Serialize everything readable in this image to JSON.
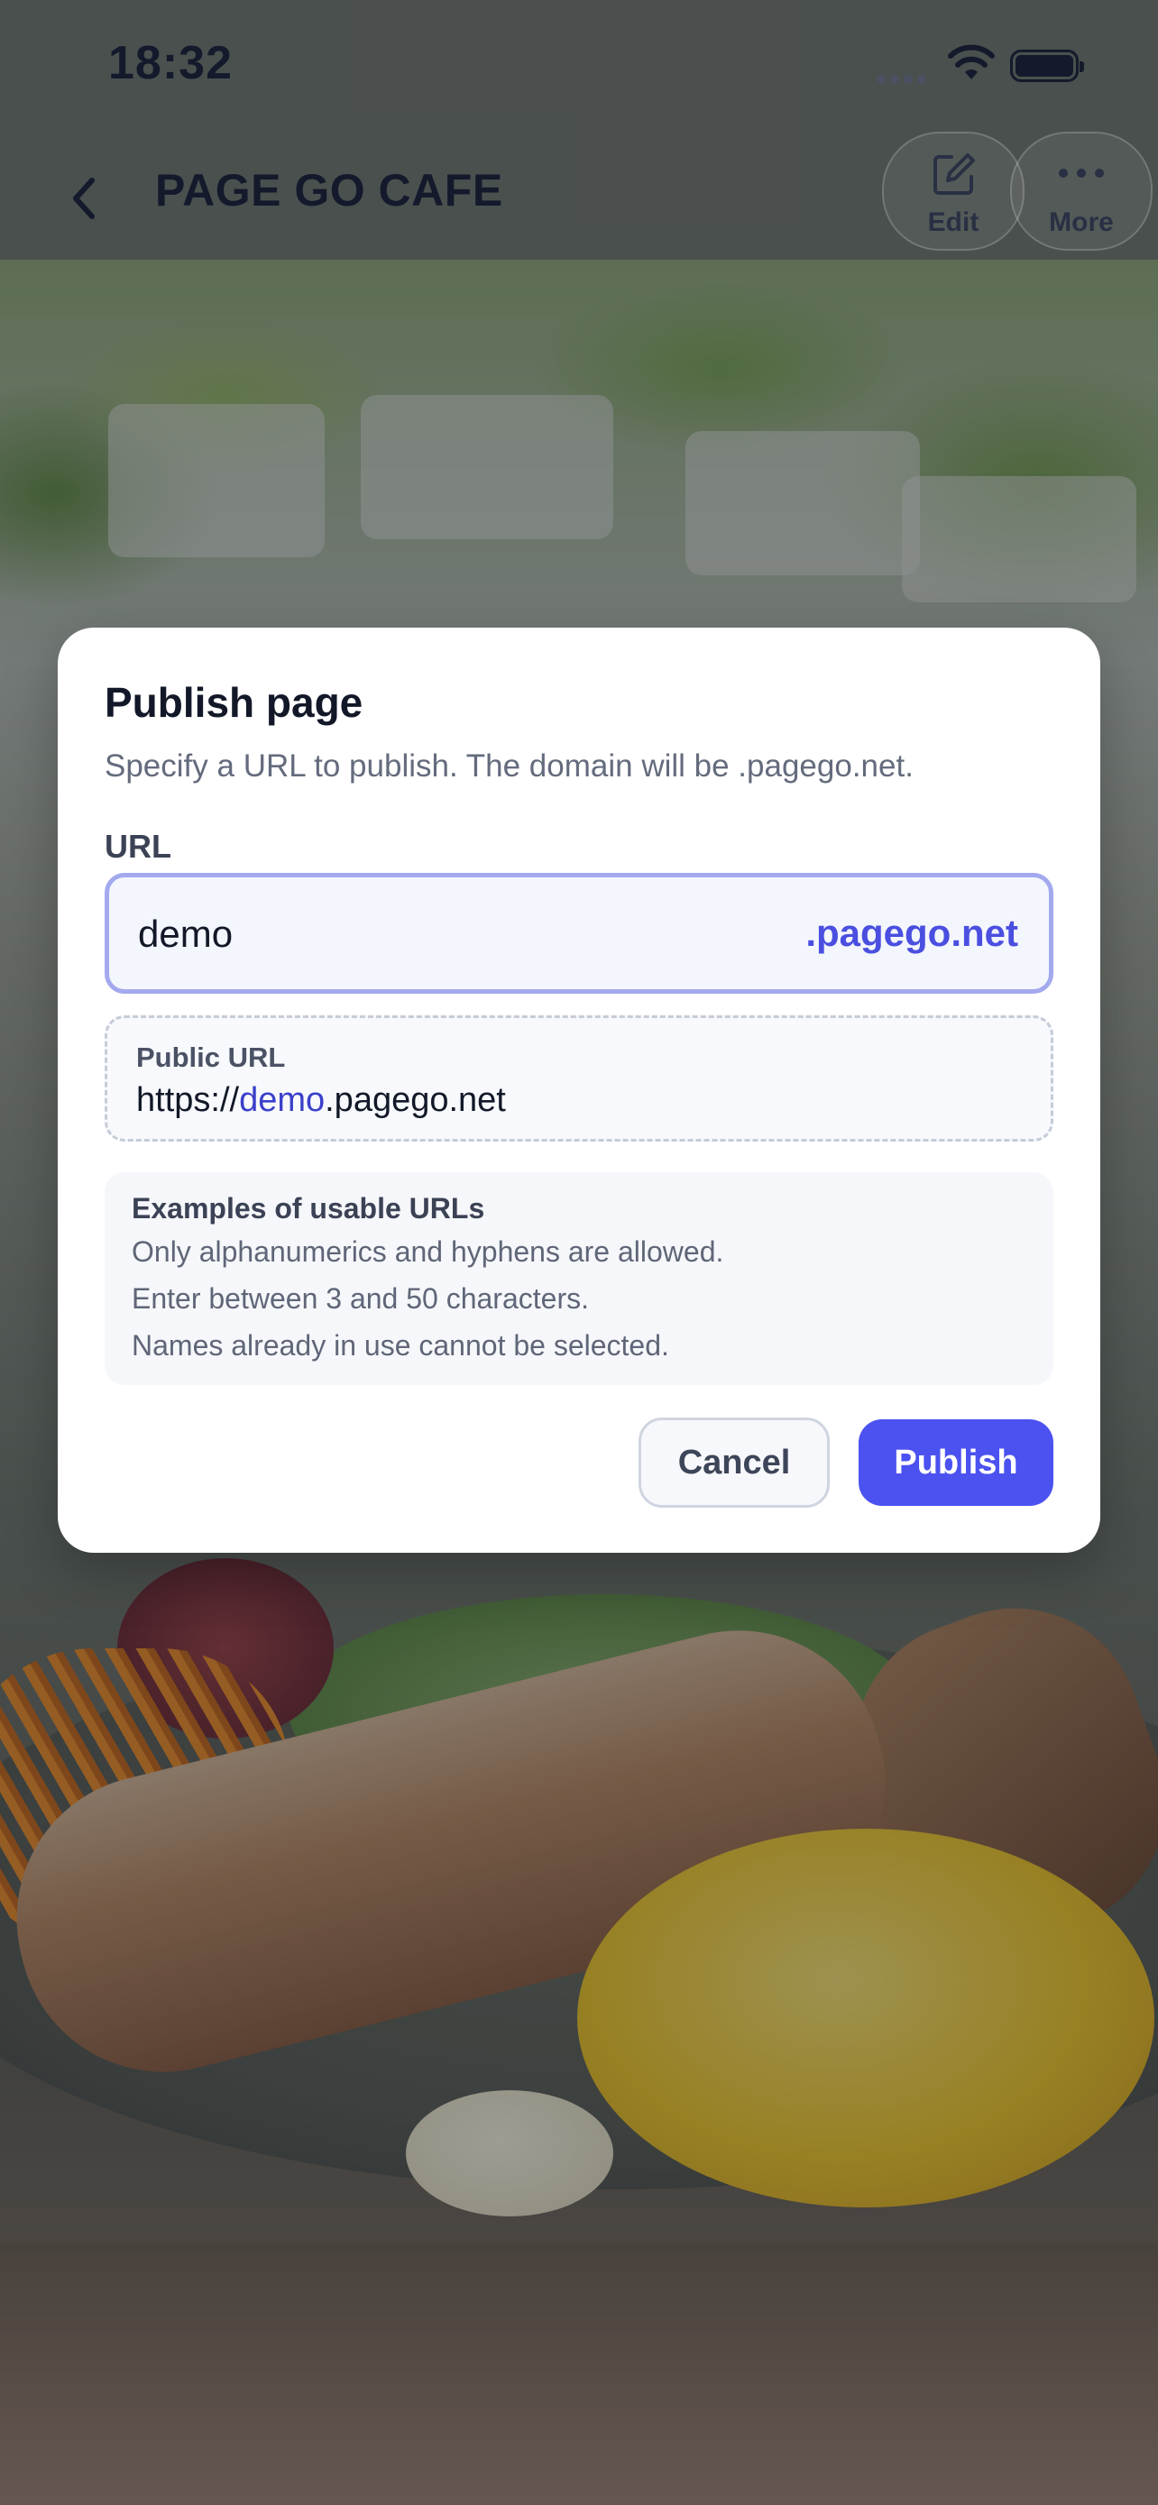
{
  "status_bar": {
    "time": "18:32"
  },
  "header": {
    "title": "PAGE GO CAFE",
    "edit_label": "Edit",
    "more_label": "More"
  },
  "dialog": {
    "title": "Publish page",
    "description": "Specify a URL to publish. The domain will be .pagego.net.",
    "url_label": "URL",
    "url_value": "demo",
    "url_suffix": ".pagego.net",
    "public_url": {
      "label": "Public URL",
      "prefix": "https://",
      "subdomain": "demo",
      "suffix": ".pagego.net"
    },
    "examples": {
      "title": "Examples of usable URLs",
      "lines": [
        "Only alphanumerics and hyphens are allowed.",
        "Enter between 3 and 50 characters.",
        "Names already in use cannot be selected."
      ]
    },
    "cancel_label": "Cancel",
    "publish_label": "Publish"
  },
  "colors": {
    "accent": "#4b52f0",
    "input_border": "#a3a9ee",
    "suffix_text": "#4a4fe0"
  },
  "icons": [
    "back-chevron-icon",
    "edit-icon",
    "more-icon",
    "wifi-icon",
    "battery-icon",
    "signal-icon"
  ]
}
